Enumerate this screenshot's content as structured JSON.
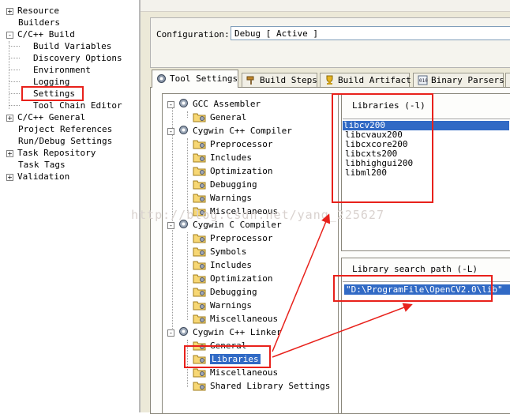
{
  "left_tree": {
    "items": [
      {
        "label": "Resource",
        "toggle": "+"
      },
      {
        "label": "Builders",
        "toggle": ""
      },
      {
        "label": "C/C++ Build",
        "toggle": "-"
      },
      {
        "label": "Build Variables",
        "toggle": ""
      },
      {
        "label": "Discovery Options",
        "toggle": ""
      },
      {
        "label": "Environment",
        "toggle": ""
      },
      {
        "label": "Logging",
        "toggle": ""
      },
      {
        "label": "Settings",
        "toggle": ""
      },
      {
        "label": "Tool Chain Editor",
        "toggle": ""
      },
      {
        "label": "C/C++ General",
        "toggle": "+"
      },
      {
        "label": "Project References",
        "toggle": ""
      },
      {
        "label": "Run/Debug Settings",
        "toggle": ""
      },
      {
        "label": "Task Repository",
        "toggle": "+"
      },
      {
        "label": "Task Tags",
        "toggle": ""
      },
      {
        "label": "Validation",
        "toggle": "+"
      }
    ]
  },
  "configuration": {
    "label": "Configuration:",
    "value": "Debug  [ Active ]"
  },
  "tabs": [
    {
      "label": "Tool Settings"
    },
    {
      "label": "Build Steps"
    },
    {
      "label": "Build Artifact"
    },
    {
      "label": "Binary Parsers"
    }
  ],
  "tool_tree": {
    "gcc_assembler": "GCC Assembler",
    "general": "General",
    "cpp_compiler": "Cygwin C++ Compiler",
    "preprocessor": "Preprocessor",
    "includes": "Includes",
    "optimization": "Optimization",
    "debugging": "Debugging",
    "warnings": "Warnings",
    "miscellaneous": "Miscellaneous",
    "c_compiler": "Cygwin C Compiler",
    "symbols": "Symbols",
    "cpp_linker": "Cygwin C++ Linker",
    "libraries": "Libraries",
    "shared": "Shared Library Settings"
  },
  "libraries": {
    "header": "Libraries (-l)",
    "items": [
      "libcv200",
      "libcvaux200",
      "libcxcore200",
      "libcxts200",
      "libhighgui200",
      "libml200"
    ]
  },
  "library_search_path": {
    "header": "Library search path (-L)",
    "items": [
      "\"D:\\ProgramFile\\OpenCV2.0\\lib\""
    ]
  },
  "watermark": "http://blog.csdn.net/yang_225627",
  "colors": {
    "selection": "#316ac5",
    "annotation": "#e8211b"
  }
}
